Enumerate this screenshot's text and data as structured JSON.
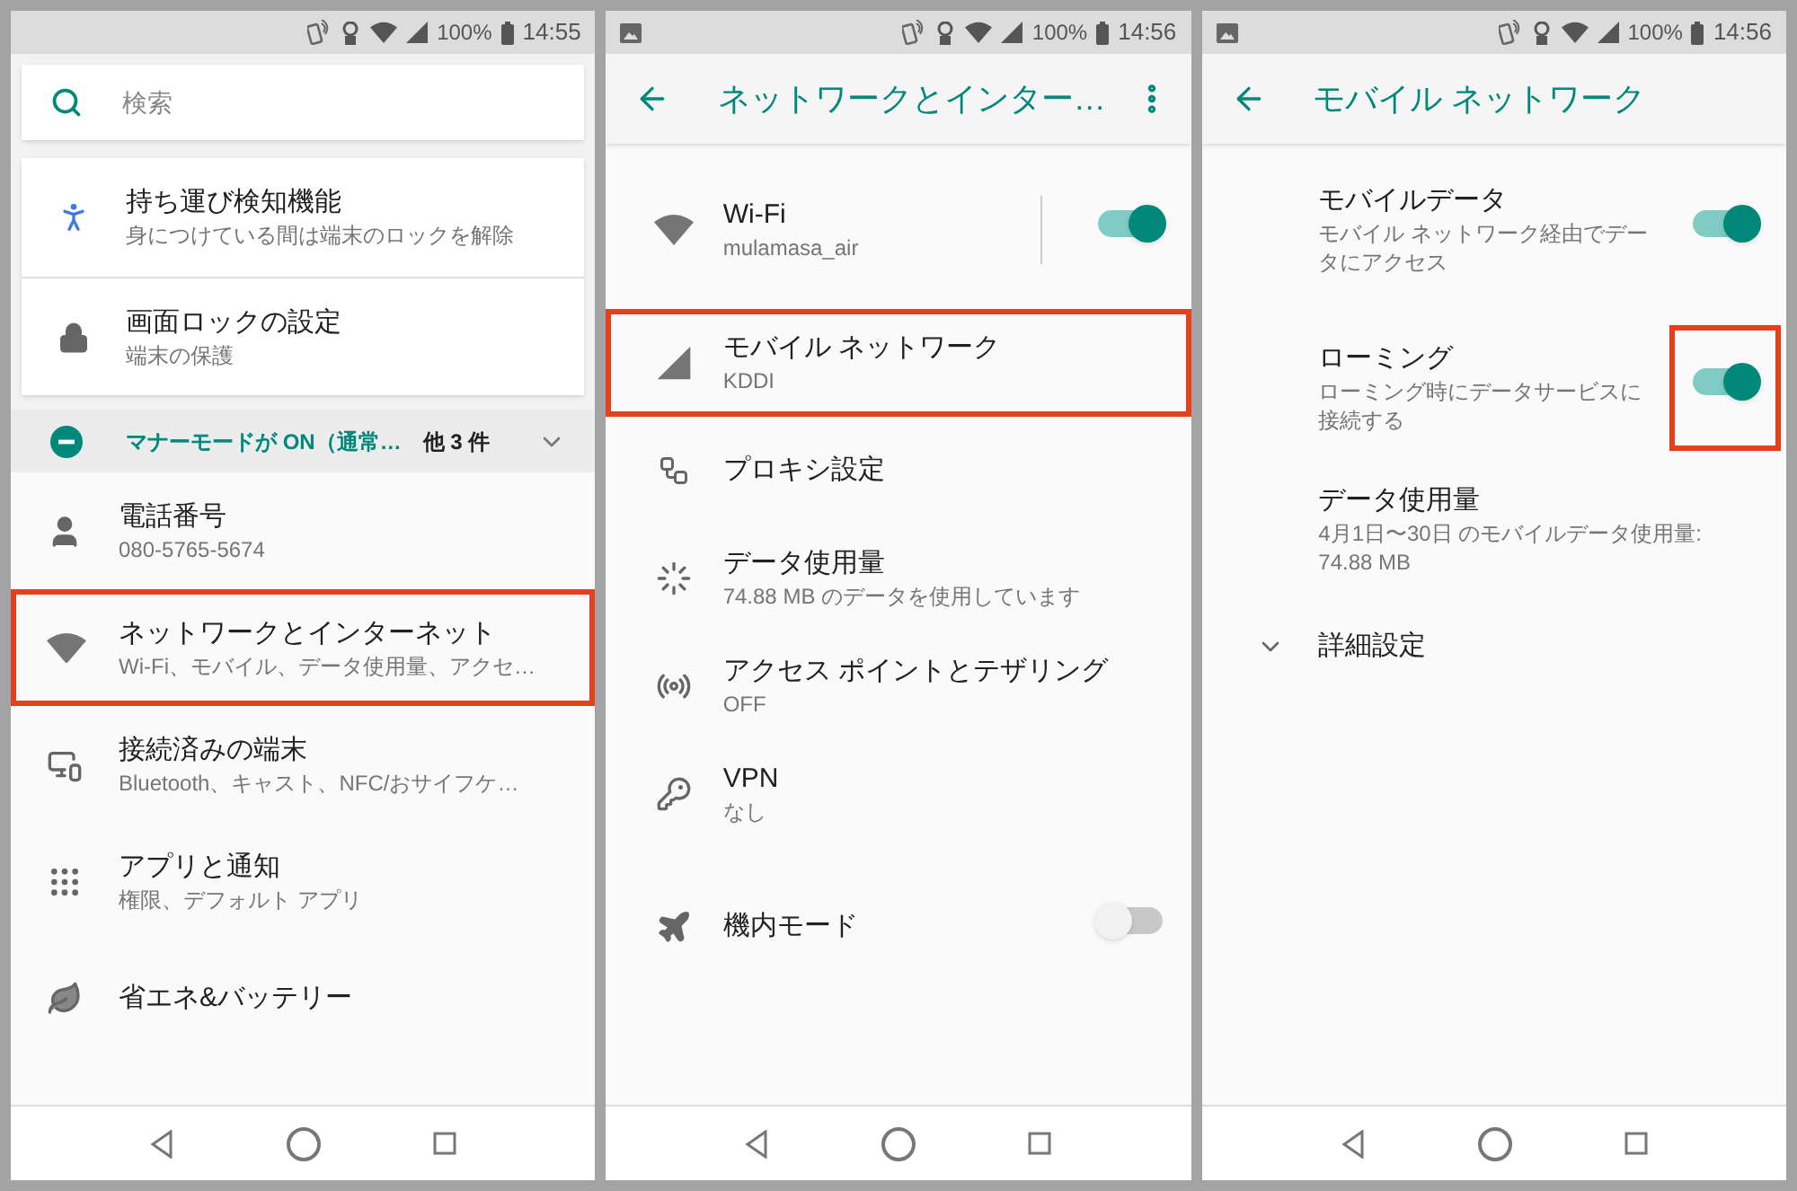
{
  "screens": [
    {
      "kind": "home",
      "status_bar": {
        "notification": false,
        "battery": "100%",
        "time": "14:55"
      },
      "search": {
        "placeholder": "検索"
      },
      "cards": [
        {
          "title": "持ち運び検知機能",
          "subtitle": "身につけている間は端末のロックを解除"
        },
        {
          "title": "画面ロックの設定",
          "subtitle": "端末の保護"
        }
      ],
      "condition": {
        "text": "マナーモードが ON（通常…",
        "more": "他 3 件"
      },
      "items": [
        {
          "title": "電話番号",
          "subtitle": "080-5765-5674"
        },
        {
          "title": "ネットワークとインターネット",
          "subtitle": "Wi-Fi、モバイル、データ使用量、アクセ…",
          "highlighted": true
        },
        {
          "title": "接続済みの端末",
          "subtitle": "Bluetooth、キャスト、NFC/おサイフケ…"
        },
        {
          "title": "アプリと通知",
          "subtitle": "権限、デフォルト アプリ"
        },
        {
          "title": "省エネ&バッテリー"
        }
      ]
    },
    {
      "kind": "sub",
      "status_bar": {
        "notification": true,
        "battery": "100%",
        "time": "14:56"
      },
      "title": "ネットワークとインター…",
      "menu": true,
      "items": [
        {
          "title": "Wi-Fi",
          "subtitle": "mulamasa_air",
          "on": true,
          "divider": true
        },
        {
          "title": "モバイル ネットワーク",
          "subtitle": "KDDI",
          "highlighted": true
        },
        {
          "title": "プロキシ設定"
        },
        {
          "title": "データ使用量",
          "subtitle": "74.88 MB のデータを使用しています"
        },
        {
          "title": "アクセス ポイントとテザリング",
          "subtitle": "OFF"
        },
        {
          "title": "VPN",
          "subtitle": "なし"
        },
        {
          "title": "機内モード",
          "on": false
        }
      ]
    },
    {
      "kind": "sub",
      "status_bar": {
        "notification": true,
        "battery": "100%",
        "time": "14:56"
      },
      "title": "モバイル ネットワーク",
      "menu": false,
      "items": [
        {
          "title": "モバイルデータ",
          "subtitle": "モバイル ネットワーク経由でデータにアクセス",
          "on": true
        },
        {
          "title": "ローミング",
          "subtitle": "ローミング時にデータサービスに接続する",
          "on": true,
          "toggle_highlighted": true
        },
        {
          "title": "データ使用量",
          "subtitle": "4月1日〜30日 のモバイルデータ使用量: 74.88 MB"
        },
        {
          "title": "詳細設定",
          "expandable": true
        }
      ]
    }
  ]
}
